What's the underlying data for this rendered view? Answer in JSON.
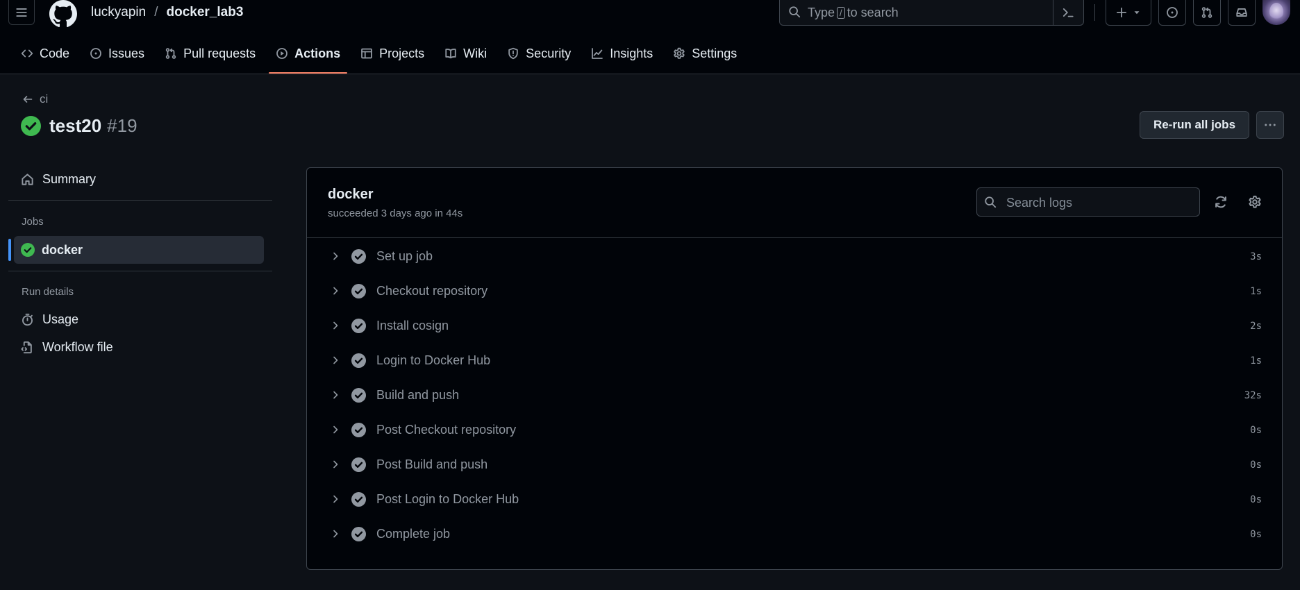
{
  "header": {
    "owner": "luckyapin",
    "separator": "/",
    "repo": "docker_lab3",
    "search_prefix": "Type",
    "search_key": "/",
    "search_suffix": "to search"
  },
  "repo_nav": [
    {
      "label": "Code",
      "icon": "code-icon"
    },
    {
      "label": "Issues",
      "icon": "issue-opened-icon"
    },
    {
      "label": "Pull requests",
      "icon": "git-pull-request-icon"
    },
    {
      "label": "Actions",
      "icon": "play-icon",
      "active": true
    },
    {
      "label": "Projects",
      "icon": "table-icon"
    },
    {
      "label": "Wiki",
      "icon": "book-icon"
    },
    {
      "label": "Security",
      "icon": "shield-icon"
    },
    {
      "label": "Insights",
      "icon": "graph-icon"
    },
    {
      "label": "Settings",
      "icon": "gear-icon"
    }
  ],
  "run": {
    "workflow": "ci",
    "name": "test20",
    "number": "#19",
    "rerun_label": "Re-run all jobs"
  },
  "sidebar": {
    "summary": "Summary",
    "jobs_heading": "Jobs",
    "job": "docker",
    "run_details_heading": "Run details",
    "usage": "Usage",
    "workflow_file": "Workflow file"
  },
  "job": {
    "name": "docker",
    "meta": "succeeded 3 days ago in 44s",
    "search_placeholder": "Search logs",
    "steps": [
      {
        "label": "Set up job",
        "duration": "3s"
      },
      {
        "label": "Checkout repository",
        "duration": "1s"
      },
      {
        "label": "Install cosign",
        "duration": "2s"
      },
      {
        "label": "Login to Docker Hub",
        "duration": "1s"
      },
      {
        "label": "Build and push",
        "duration": "32s"
      },
      {
        "label": "Post Checkout repository",
        "duration": "0s"
      },
      {
        "label": "Post Build and push",
        "duration": "0s"
      },
      {
        "label": "Post Login to Docker Hub",
        "duration": "0s"
      },
      {
        "label": "Complete job",
        "duration": "0s"
      }
    ]
  },
  "colors": {
    "background": "#0d1117",
    "header_bg": "#010409",
    "success": "#3fb950",
    "accent_underline": "#f78166",
    "selected_marker": "#4493f8"
  }
}
